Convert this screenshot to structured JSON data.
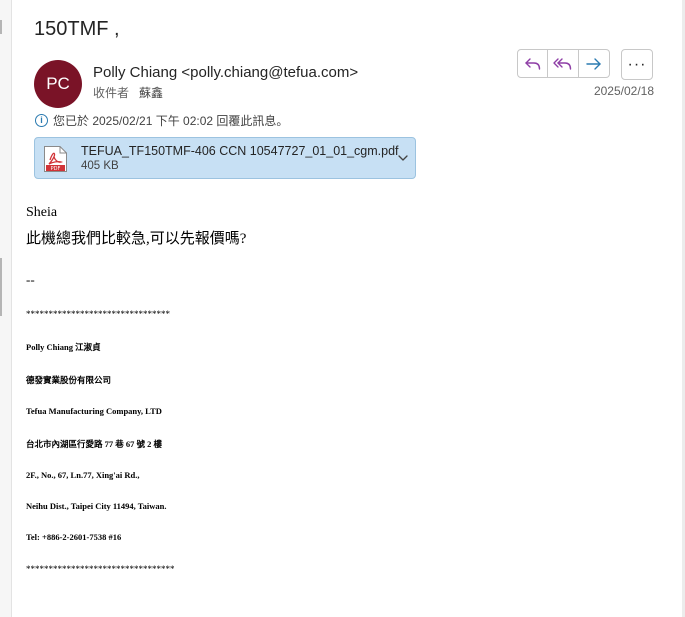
{
  "email": {
    "subject": "150TMF ,",
    "avatar_initials": "PC",
    "sender": "Polly Chiang <polly.chiang@tefua.com>",
    "to_label": "收件者",
    "to_name": "蘇鑫",
    "date": "2025/02/18",
    "reply_notice": "您已於 2025/02/21 下午 02:02 回覆此訊息。"
  },
  "actions": {
    "reply": "reply-icon",
    "reply_all": "reply-all-icon",
    "forward": "forward-icon",
    "more": "···"
  },
  "attachment": {
    "filename": "TEFUA_TF150TMF-406  CCN 10547727_01_01_cgm.pdf",
    "size": "405 KB",
    "type_label": "PDF"
  },
  "body": {
    "greeting": "Sheia",
    "message": "此機總我們比較急,可以先報價嗎?",
    "separator": "--",
    "signature": [
      "********************************",
      "Polly Chiang  江淑貞",
      "德發實業股份有限公司",
      "Tefua Manufacturing Company, LTD",
      "台北市內湖區行愛路 77 巷 67 號 2 樓",
      "2F., No., 67, Ln.77, Xing'ai Rd.,",
      "Neihu Dist., Taipei City 11494, Taiwan.",
      "Tel: +886-2-2601-7538 #16",
      "*********************************"
    ]
  },
  "colors": {
    "avatar": "#7a1327",
    "attachment_bg": "#c7e0f4",
    "reply_icon": "#8e3ea6",
    "forward_icon": "#2a7ab0",
    "pdf_red": "#d13438"
  }
}
